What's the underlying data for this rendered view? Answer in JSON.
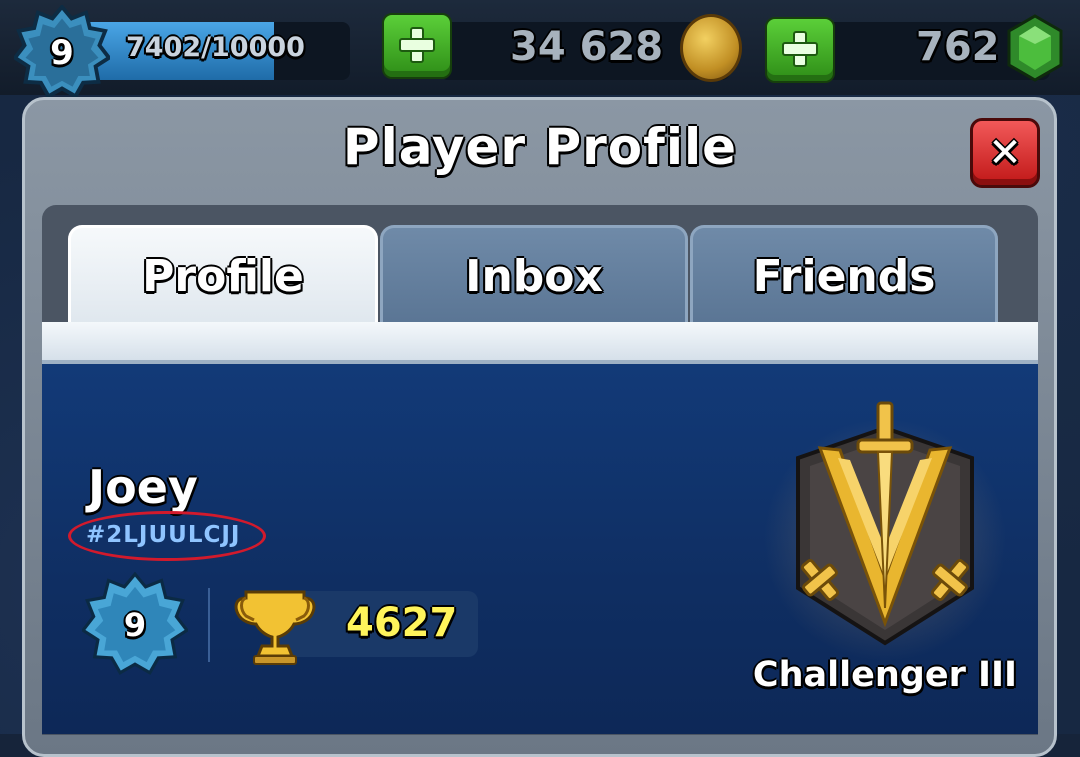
{
  "top_bar": {
    "level": "9",
    "xp_text": "7402/10000",
    "xp_progress": 0.74,
    "gold": "34 628",
    "gems": "762"
  },
  "dialog": {
    "title": "Player Profile",
    "tabs": [
      {
        "label": "Profile",
        "active": true
      },
      {
        "label": "Inbox",
        "active": false
      },
      {
        "label": "Friends",
        "active": false
      }
    ]
  },
  "profile": {
    "name": "Joey",
    "tag": "#2LJUULCJJ",
    "level": "9",
    "trophies": "4627",
    "arena": "Challenger III"
  },
  "colors": {
    "accent_blue": "#123a78",
    "trophy_text": "#fff45b",
    "close_red": "#d82020",
    "plus_green": "#3fa925",
    "tag_highlight": "#d21a2c"
  },
  "icons": [
    "level-star-icon",
    "plus-icon",
    "gold-coin-icon",
    "gem-icon",
    "close-icon",
    "trophy-icon",
    "arena-swords-icon"
  ]
}
